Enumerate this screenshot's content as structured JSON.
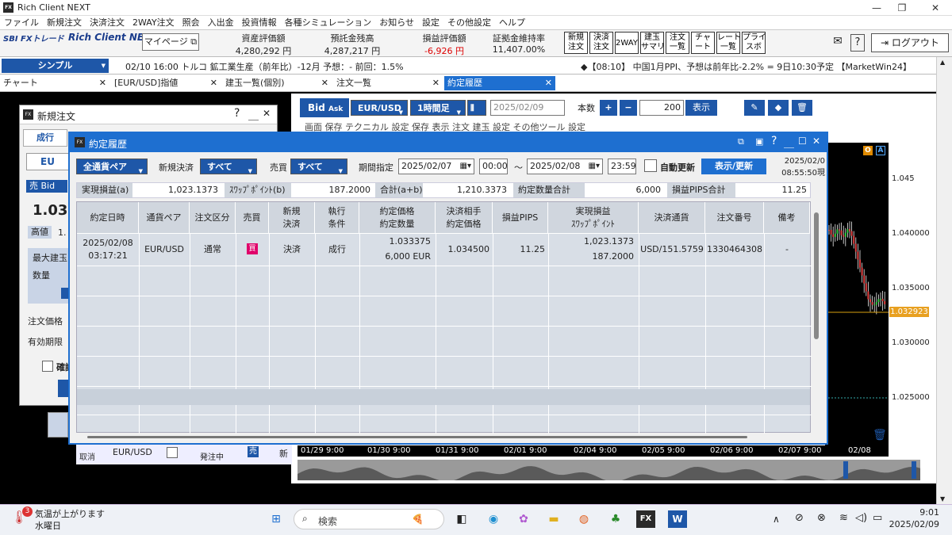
{
  "app": {
    "title": "Rich Client NEXT",
    "min": "—",
    "max": "❐",
    "close": "✕"
  },
  "menu": [
    "ファイル",
    "新規注文",
    "決済注文",
    "2WAY注文",
    "照会",
    "入出金",
    "投資情報",
    "各種シミュレーション",
    "お知らせ",
    "設定",
    "その他設定",
    "ヘルプ"
  ],
  "toolbar": {
    "logo1": "SBI FXトレード",
    "logo2": "Rich Client NEXT",
    "mypage": "マイページ ⧉",
    "metrics": [
      {
        "label": "資産評価額",
        "value": "4,280,292 円"
      },
      {
        "label": "預託金残高",
        "value": "4,287,217 円"
      },
      {
        "label": "損益評価額",
        "value": "-6,926 円"
      },
      {
        "label": "証拠金維持率",
        "value": "11,407.00%"
      }
    ],
    "buttons": [
      "新規\n注文",
      "決済\n注文",
      "2WAY",
      "建玉\nサマリ",
      "注文\n一覧",
      "チャ\nート",
      "レート\n一覧",
      "プライ\nスボ"
    ],
    "logout": "ログアウト"
  },
  "mode": "シンプル",
  "news_left": "02/10 16:00 トルコ 鉱工業生産（前年比）-12月 予想：- 前回：1.5%",
  "news_right": "◆【08:10】 中国1月PPI、予想は前年比-2.2% = 9日10:30予定 【MarketWin24】",
  "tabs": [
    {
      "label": "チャート",
      "x": "✕"
    },
    {
      "label": "[EUR/USD]指値",
      "x": "✕"
    },
    {
      "label": "建玉一覧(個別)",
      "x": "✕"
    },
    {
      "label": "注文一覧",
      "x": "✕"
    },
    {
      "label": "約定履歴",
      "x": "✕"
    }
  ],
  "chart": {
    "bid": "Bid",
    "ask": "Ask",
    "pair": "EUR/USD",
    "tf": "1時間足",
    "date": "2025/02/09",
    "qty_label": "本数",
    "qty": "200",
    "show": "表示",
    "row2": [
      "画面",
      "保存",
      "テクニカル",
      "設定",
      "保存",
      "表示",
      "注文",
      "建玉",
      "設定",
      "その他ツール",
      "設定"
    ],
    "price": "1.032923",
    "xlabels": [
      "01/29 9:00",
      "01/30 9:00",
      "01/31 9:00",
      "02/01 9:00",
      "02/04 9:00",
      "02/05 9:00",
      "02/06 9:00",
      "02/07 9:00",
      "02/08"
    ]
  },
  "chart_data": {
    "type": "line",
    "x": [],
    "y": [],
    "y_ticks": [
      1.045,
      1.04,
      1.035,
      1.03,
      1.025
    ],
    "current_price": 1.032923,
    "ylim": [
      1.022,
      1.048
    ]
  },
  "newwin": {
    "title": "新規注文",
    "help": "?",
    "min": "＿",
    "close": "✕",
    "order_type": "成行",
    "sym_prefix": "EU",
    "side": "売 Bid",
    "rate_prefix": "1.03",
    "high": "高値",
    "high_prefix": "1.",
    "max": "最大建玉",
    "qty": "数量",
    "price": "注文価格",
    "expiry": "有効期限",
    "confirm": "確認",
    "bottom_pair": "EUR/USD",
    "bottom_cell": "取消",
    "bottom_side": "売",
    "bottom_status": "発注中",
    "bottom_new": "新"
  },
  "dialog": {
    "title": "約定履歴",
    "winctl": [
      "?",
      "＿",
      "☐",
      "✕"
    ],
    "pair_sel": "全通貨ペア",
    "newclose_label": "新規決済",
    "newclose": "すべて",
    "side_label": "売買",
    "side": "すべて",
    "period_label": "期間指定",
    "from_date": "2025/02/07",
    "from_time": "00:00",
    "tilde": "～",
    "to_date": "2025/02/08",
    "to_time": "23:59",
    "auto": "自動更新",
    "refresh": "表示/更新",
    "ts1": "2025/02/0",
    "ts2": "08:55:50現",
    "summary": [
      {
        "label": "実現損益(a)",
        "value": "1,023.1373"
      },
      {
        "label": "ｽﾜｯﾌﾟﾎﾟｲﾝﾄ(b)",
        "value": "187.2000"
      },
      {
        "label": "合計(a+b)",
        "value": "1,210.3373"
      },
      {
        "label": "約定数量合計",
        "value": "6,000"
      },
      {
        "label": "損益PIPS合計",
        "value": "11.25"
      }
    ],
    "columns": [
      "約定日時",
      "通貨ペア",
      "注文区分",
      "売買",
      "新規\n決済",
      "執行\n条件",
      "約定価格\n約定数量",
      "決済相手\n約定価格",
      "損益PIPS",
      "実現損益\nｽﾜｯﾌﾟﾎﾟｲﾝﾄ",
      "決済通貨",
      "注文番号",
      "備考"
    ],
    "row": {
      "datetime1": "2025/02/08",
      "datetime2": "03:17:21",
      "pair": "EUR/USD",
      "type": "通常",
      "side": "買",
      "newclose": "決済",
      "cond": "成行",
      "price": "1.033375",
      "qty": "6,000 EUR",
      "counter": "1.034500",
      "pips": "11.25",
      "pnl": "1,023.1373",
      "swap": "187.2000",
      "ccy": "USD/151.5759",
      "orderno": "1330464308",
      "note": "-"
    }
  },
  "taskbar": {
    "weather_badge": "3",
    "weather1": "気温が上がります",
    "weather2": "水曜日",
    "search": "検索",
    "time": "9:01",
    "date": "2025/02/09"
  }
}
